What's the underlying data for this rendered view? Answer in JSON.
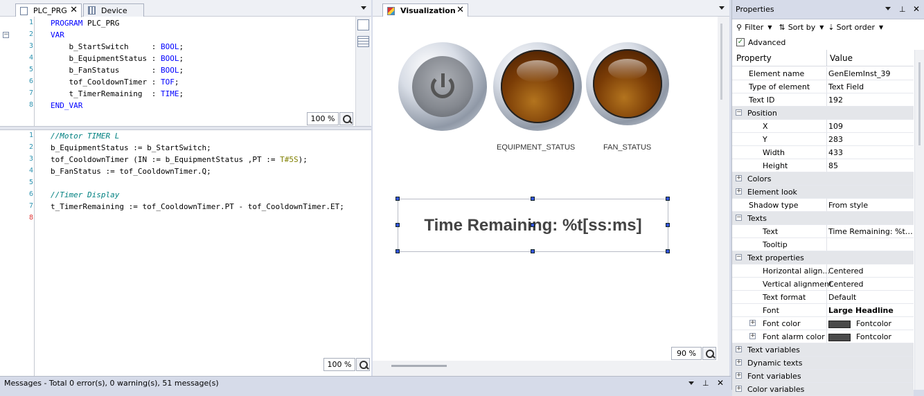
{
  "left_pane": {
    "tabs": [
      {
        "label": "PLC_PRG"
      },
      {
        "label": "Device"
      }
    ],
    "decl_lines": [
      {
        "n": "1",
        "parts": [
          [
            "kw",
            "PROGRAM"
          ],
          [
            "",
            " PLC_PRG"
          ]
        ]
      },
      {
        "n": "2",
        "parts": [
          [
            "kw",
            "VAR"
          ]
        ]
      },
      {
        "n": "3",
        "parts": [
          [
            "",
            "    b_StartSwitch     : "
          ],
          [
            "kw",
            "BOOL"
          ],
          [
            "",
            ";"
          ]
        ]
      },
      {
        "n": "4",
        "parts": [
          [
            "",
            "    b_EquipmentStatus : "
          ],
          [
            "kw",
            "BOOL"
          ],
          [
            "",
            ";"
          ]
        ]
      },
      {
        "n": "5",
        "parts": [
          [
            "",
            "    b_FanStatus       : "
          ],
          [
            "kw",
            "BOOL"
          ],
          [
            "",
            ";"
          ]
        ]
      },
      {
        "n": "6",
        "parts": [
          [
            "",
            "    tof_CooldownTimer : "
          ],
          [
            "kw",
            "TOF"
          ],
          [
            "",
            ";"
          ]
        ]
      },
      {
        "n": "7",
        "parts": [
          [
            "",
            "    t_TimerRemaining  : "
          ],
          [
            "kw",
            "TIME"
          ],
          [
            "",
            ";"
          ]
        ]
      },
      {
        "n": "8",
        "parts": [
          [
            "kw",
            "END_VAR"
          ]
        ]
      }
    ],
    "impl_lines": [
      {
        "n": "1",
        "parts": [
          [
            "cm",
            "//Motor TIMER L"
          ]
        ]
      },
      {
        "n": "2",
        "parts": [
          [
            "",
            "b_EquipmentStatus := b_StartSwitch;"
          ]
        ]
      },
      {
        "n": "3",
        "parts": [
          [
            "",
            "tof_CooldownTimer (IN := b_EquipmentStatus ,PT := "
          ],
          [
            "lit",
            "T#5S"
          ],
          [
            "",
            ");"
          ]
        ]
      },
      {
        "n": "4",
        "parts": [
          [
            "",
            "b_FanStatus := tof_CooldownTimer.Q;"
          ]
        ]
      },
      {
        "n": "5",
        "parts": [
          [
            "",
            ""
          ]
        ]
      },
      {
        "n": "6",
        "parts": [
          [
            "cm",
            "//Timer Display"
          ]
        ]
      },
      {
        "n": "7",
        "parts": [
          [
            "",
            "t_TimerRemaining := tof_CooldownTimer.PT - tof_CooldownTimer.ET;"
          ]
        ]
      },
      {
        "n": "8",
        "parts": [
          [
            "",
            ""
          ]
        ]
      }
    ],
    "decl_zoom": "100 %",
    "impl_zoom": "100 %"
  },
  "visualization": {
    "tab_label": "Visualization",
    "labels": {
      "equipment": "EQUIPMENT_STATUS",
      "fan": "FAN_STATUS"
    },
    "text_field": "Time Remaining: %t[ss:ms]",
    "zoom": "90 %"
  },
  "properties": {
    "title": "Properties",
    "toolbar": {
      "filter": "Filter",
      "sort_by": "Sort by",
      "sort_order": "Sort order",
      "advanced": "Advanced"
    },
    "header": {
      "property": "Property",
      "value": "Value"
    },
    "rows": [
      {
        "name": "Element name",
        "value": "GenElemInst_39",
        "indent": 1
      },
      {
        "name": "Type of element",
        "value": "Text Field",
        "indent": 1
      },
      {
        "name": "Text ID",
        "value": "192",
        "indent": 1
      },
      {
        "name": "Position",
        "value": "",
        "indent": 0,
        "cat": true,
        "exp": "−"
      },
      {
        "name": "X",
        "value": "109",
        "indent": 2
      },
      {
        "name": "Y",
        "value": "283",
        "indent": 2
      },
      {
        "name": "Width",
        "value": "433",
        "indent": 2
      },
      {
        "name": "Height",
        "value": "85",
        "indent": 2
      },
      {
        "name": "Colors",
        "value": "",
        "indent": 0,
        "cat": true,
        "exp": "+"
      },
      {
        "name": "Element look",
        "value": "",
        "indent": 0,
        "cat": true,
        "exp": "+"
      },
      {
        "name": "Shadow type",
        "value": "From style",
        "indent": 1
      },
      {
        "name": "Texts",
        "value": "",
        "indent": 0,
        "cat": true,
        "exp": "−"
      },
      {
        "name": "Text",
        "value": "Time Remaining: %t[s...",
        "indent": 2
      },
      {
        "name": "Tooltip",
        "value": "",
        "indent": 2
      },
      {
        "name": "Text properties",
        "value": "",
        "indent": 0,
        "cat": true,
        "exp": "−"
      },
      {
        "name": "Horizontal align...",
        "value": "Centered",
        "indent": 2
      },
      {
        "name": "Vertical alignment",
        "value": "Centered",
        "indent": 2
      },
      {
        "name": "Text format",
        "value": "Default",
        "indent": 2
      },
      {
        "name": "Font",
        "value": "Large Headline",
        "indent": 2,
        "bold": true
      },
      {
        "name": "Font color",
        "value": "Fontcolor",
        "indent": 2,
        "exp2": "+",
        "swatch": true
      },
      {
        "name": "Font alarm color",
        "value": "Fontcolor",
        "indent": 2,
        "exp2": "+",
        "swatch": true
      },
      {
        "name": "Text variables",
        "value": "",
        "indent": 0,
        "cat": true,
        "exp": "+"
      },
      {
        "name": "Dynamic texts",
        "value": "",
        "indent": 0,
        "cat": true,
        "exp": "+"
      },
      {
        "name": "Font variables",
        "value": "",
        "indent": 0,
        "cat": true,
        "exp": "+"
      },
      {
        "name": "Color variables",
        "value": "",
        "indent": 0,
        "cat": true,
        "exp": "+"
      }
    ]
  },
  "messages": {
    "text": "Messages - Total 0 error(s), 0 warning(s), 51 message(s)"
  }
}
